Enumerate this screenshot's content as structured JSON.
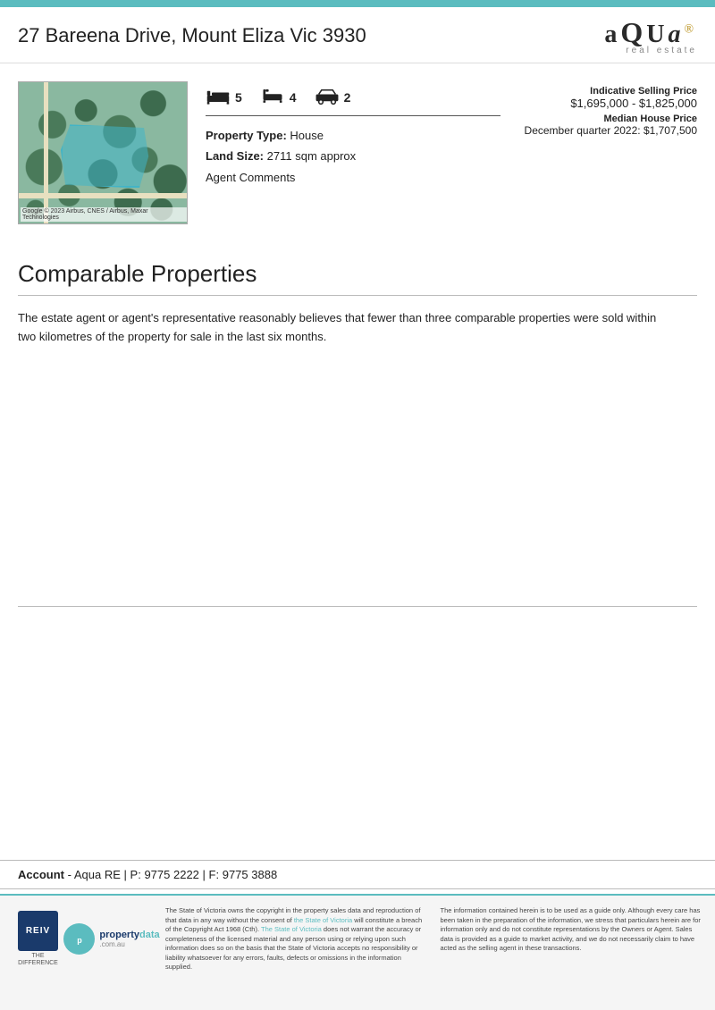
{
  "header": {
    "title": "27 Bareena Drive, Mount Eliza Vic 3930",
    "logo_text": "aQUa",
    "logo_sub": "real estate"
  },
  "property": {
    "beds": "5",
    "baths": "4",
    "cars": "2",
    "type_label": "Property Type:",
    "type_value": "House",
    "land_label": "Land Size:",
    "land_value": "2711 sqm approx",
    "agent_comments": "Agent Comments",
    "price_label": "Indicative Selling Price",
    "price_range": "$1,695,000 - $1,825,000",
    "median_label": "Median House Price",
    "median_value": "December quarter 2022: $1,707,500"
  },
  "comparable": {
    "section_title": "Comparable Properties",
    "body_text": "The estate agent or agent's representative reasonably believes that fewer than three comparable properties were sold within two kilometres of the property for sale in the last six months."
  },
  "account": {
    "label": "Account",
    "name": "Aqua RE",
    "phone_label": "P:",
    "phone": "9775 2222",
    "fax_label": "F:",
    "fax": "9775 3888"
  },
  "footer": {
    "reiv_text": "REIV",
    "reiv_sub": "THE DIFFERENCE",
    "propdata_name": "property",
    "propdata_tld": "data",
    "propdata_domain": ".com.au",
    "disclaimer_left": "The State of Victoria owns the copyright in the property sales data and reproduction of that data in any way without the consent of the State of Victoria will constitute a breach of the Copyright Act 1968 (Cth). The State of Victoria does not warrant the accuracy or completeness of the licensed material and any person using or relying upon such information does so on the basis that the State of Victoria accepts no responsibility or liability whatsoever for any errors, faults, defects or omissions in the information supplied.",
    "disclaimer_right": "The information contained herein is to be used as a guide only. Although every care has been taken in the preparation of the information, we stress that particulars herein are for information only and do not constitute representations by the Owners or Agent. Sales data is provided as a guide to market activity, and we do not necessarily claim to have acted as the selling agent in these transactions.",
    "highlight_text": "The State of Victoria"
  }
}
